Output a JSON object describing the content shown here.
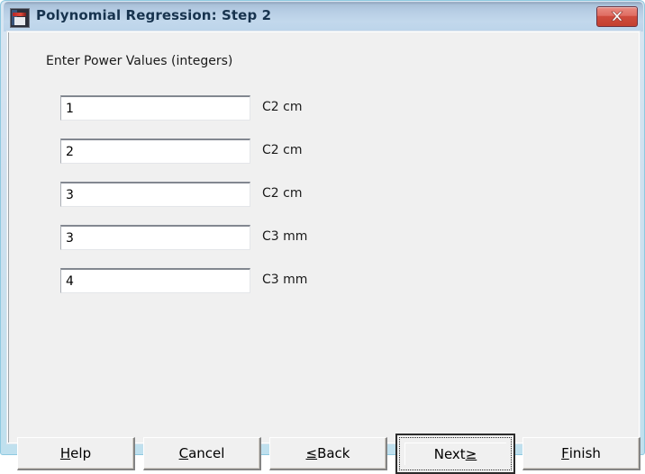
{
  "window": {
    "title": "Polynomial Regression: Step 2",
    "icon": "minitab-app-icon",
    "close_label": "✕",
    "accent_titlebar": "#b6cde4",
    "accent_close": "#cf4b3e",
    "dialog_background": "#f0f0f0"
  },
  "dialog": {
    "heading": "Enter Power Values (integers)",
    "rows": [
      {
        "value": "1",
        "placeholder": "",
        "label": "C2 cm"
      },
      {
        "value": "2",
        "placeholder": "",
        "label": "C2 cm"
      },
      {
        "value": "3",
        "placeholder": "",
        "label": "C2 cm"
      },
      {
        "value": "3",
        "placeholder": "",
        "label": "C3 mm"
      },
      {
        "value": "4",
        "placeholder": "",
        "label": "C3 mm"
      }
    ]
  },
  "buttons": {
    "help": {
      "accel": "H",
      "rest": "elp",
      "full": "Help"
    },
    "cancel": {
      "accel": "C",
      "rest": "ancel",
      "full": "Cancel"
    },
    "back": {
      "accel": "≤",
      "rest": " Back",
      "full": "≤ Back"
    },
    "next": {
      "accel": "",
      "pre": "Next ",
      "accel2": "≥",
      "full": "Next ≥",
      "is_default": "true"
    },
    "finish": {
      "accel": "F",
      "rest": "inish",
      "full": "Finish"
    }
  }
}
